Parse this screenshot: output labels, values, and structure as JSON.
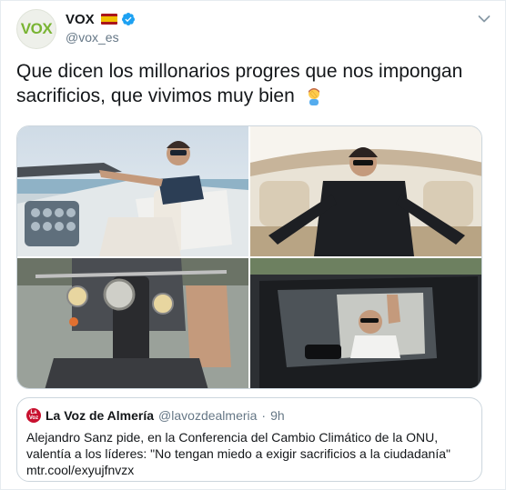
{
  "author": {
    "avatar_text": "VOX",
    "name": "VOX",
    "handle": "@vox_es"
  },
  "tweet": {
    "text": "Que dicen los millonarios progres que nos impongan sacrificios, que vivimos muy bien"
  },
  "quote": {
    "name": "La Voz de Almería",
    "handle": "@lavozdealmeria",
    "separator": "·",
    "time": "9h",
    "logo_text": "La Voz",
    "text": "Alejandro Sanz pide, en la Conferencia del Cambio Climático  de la ONU, valentía a los líderes: \"No tengan miedo a exigir sacrificios a la ciudadanía\"",
    "link": "mtr.cool/exyujfnvzx"
  },
  "colors": {
    "vox_green": "#79b433",
    "verified_blue": "#1da1f2",
    "secondary_text": "#657786",
    "quote_logo_red": "#c8102e"
  }
}
